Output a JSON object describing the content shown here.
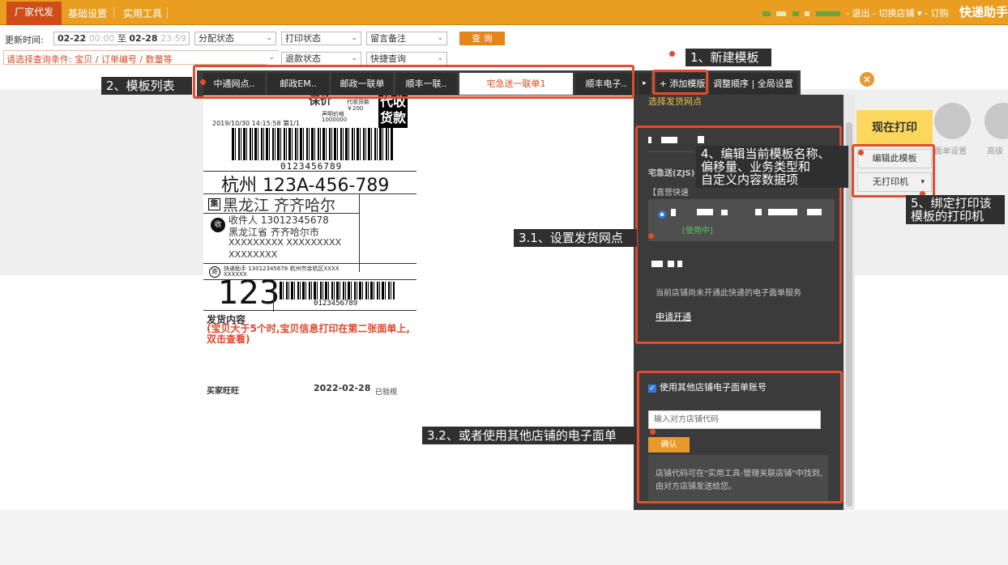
{
  "topbar": {
    "tabs": [
      "厂家代发",
      "基础设置",
      "实用工具"
    ],
    "right_links": "- 退出 - 切换店铺 ▾ - 订购",
    "brand": "快递助手"
  },
  "filter": {
    "update_time_label": "更新时间:",
    "date_from": "02-22",
    "time_from": "00:00",
    "to_label": "至",
    "date_to": "02-28",
    "time_to": "23:59",
    "selects_row1": [
      "分配状态",
      "打印状态",
      "留言备注"
    ],
    "query_button": "查 询",
    "condition_hint": "请选择查询条件:  宝贝 / 订单编号 / 数量等",
    "selects_row2": [
      "退款状态",
      "快捷查询"
    ]
  },
  "template_tabs": [
    "中通网点..",
    "邮政EM..",
    "邮政一联单",
    "顺丰一联..",
    "宅急送一联单1",
    "顺丰电子.."
  ],
  "tab_arrow": "▸",
  "add_template": "+ 添加模版",
  "order_settings": "调整顺序 | 全局设置",
  "label_preview": {
    "price_word": "保价",
    "declared_value_label": "声明价格",
    "declared_value": "1000000",
    "cod_label": "代收货款",
    "cod_amount": "￥200",
    "cod_big": "代收货款",
    "print_time": "2019/10/30 14:15:58 第1/1",
    "tracking_number": "0123456789",
    "sort_code": "杭州 123A-456-789",
    "collect_icon": "集",
    "dest_area": "黑龙江 齐齐哈尔",
    "receive_icon": "收",
    "receiver": "收件人 13012345678",
    "receiver_addr1": "黑龙江省 齐齐哈尔市",
    "receiver_addr2": "XXXXXXXXX XXXXXXXXX",
    "receiver_addr3": "XXXXXXXX",
    "send_icon": "寄",
    "sender": "快递助手  13012345678  杭州市余杭区XXXX",
    "sender_addr": "XXXXXX",
    "big_code": "123",
    "tracking_number2": "0123456789",
    "content_title": "发货内容",
    "content_note": "(宝贝大于5个时,宝贝信息打印在第二张面单上,双击查看)",
    "buyer": "买家旺旺",
    "date": "2022-02-28",
    "inspected": "已验视"
  },
  "panel": {
    "title": "选择发货网点",
    "courier_label": "宅急送(ZJS)",
    "direct_label": "【直营快速",
    "in_use": "[使用中]",
    "not_opened": "当前店铺尚未开通此快递的电子面单服务",
    "apply_link": "申请开通",
    "use_other_label": "使用其他店铺电子面单账号",
    "shop_code_placeholder": "输入对方店铺代码",
    "confirm": "确认",
    "hint": "店铺代码可在\"实用工具-管理关联店铺\"中找到, 由对方店铺发送给您。"
  },
  "right_actions": {
    "print_now": "现在打印",
    "edit_template": "编辑此模板",
    "no_printer": "无打印机",
    "face_settings": "面单设置",
    "advanced": "高级"
  },
  "annotations": {
    "a1": "1、新建模板",
    "a2": "2、模板列表",
    "a31": "3.1、设置发货网点",
    "a32": "3.2、或者使用其他店铺的电子面单",
    "a4_line1": "4、编辑当前模板名称、",
    "a4_line2": "偏移量、业务类型和",
    "a4_line3": "自定义内容数据项",
    "a5_line1": "5、绑定打印该",
    "a5_line2": "模板的打印机"
  }
}
